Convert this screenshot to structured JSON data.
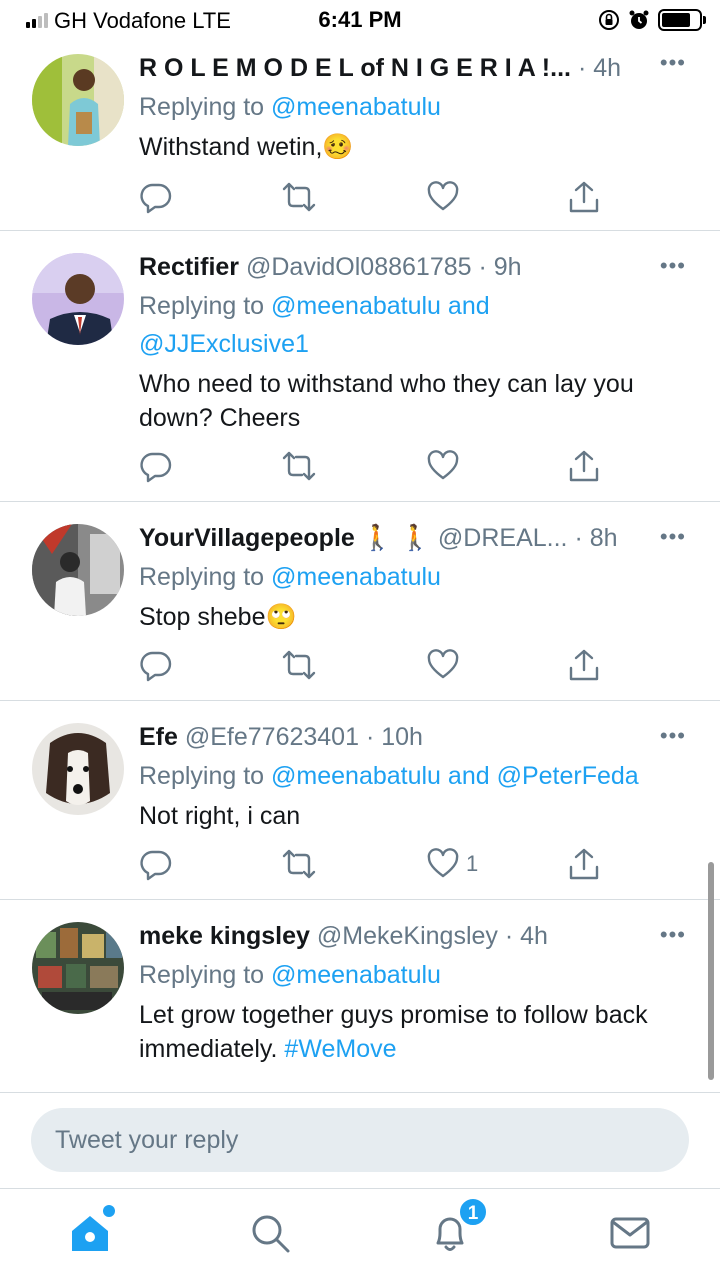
{
  "status_bar": {
    "carrier": "GH Vodafone  LTE",
    "time": "6:41 PM"
  },
  "tweets": [
    {
      "name": "R O L E M O D E L of N I G E R I A !...",
      "handle": "",
      "time": "· 4h",
      "replying_prefix": "Replying to ",
      "mentions": "@meenabatulu",
      "text": "Withstand wetin,",
      "emoji": "🥴",
      "like_count": ""
    },
    {
      "name": "Rectifier",
      "handle": "@DavidOl08861785",
      "time": "· 9h",
      "replying_prefix": "Replying to ",
      "mentions": "@meenabatulu and @JJExclusive1",
      "text": "Who need to withstand who they can lay you down? Cheers",
      "emoji": "",
      "like_count": ""
    },
    {
      "name": "YourVillagepeople 🚶 🚶",
      "handle": "@DREAL...",
      "time": "· 8h",
      "replying_prefix": "Replying to ",
      "mentions": "@meenabatulu",
      "text": "Stop shebe",
      "emoji": "🙄",
      "like_count": ""
    },
    {
      "name": "Efe",
      "handle": "@Efe77623401",
      "time": "· 10h",
      "replying_prefix": "Replying to ",
      "mentions": "@meenabatulu and @PeterFeda",
      "text": "Not right,  i can",
      "emoji": "",
      "like_count": "1"
    },
    {
      "name": "meke kingsley",
      "handle": "@MekeKingsley",
      "time": "· 4h",
      "replying_prefix": "Replying to ",
      "mentions": "@meenabatulu",
      "text": "Let grow together guys promise to follow back immediately. ",
      "hashtag": "#WeMove",
      "emoji": "",
      "like_count": ""
    }
  ],
  "reply_box": {
    "placeholder": "Tweet your reply"
  },
  "tab_bar": {
    "notifications_badge": "1"
  },
  "colors": {
    "accent": "#1da1f2",
    "secondary_text": "#657786",
    "divider": "#d7dde1"
  }
}
